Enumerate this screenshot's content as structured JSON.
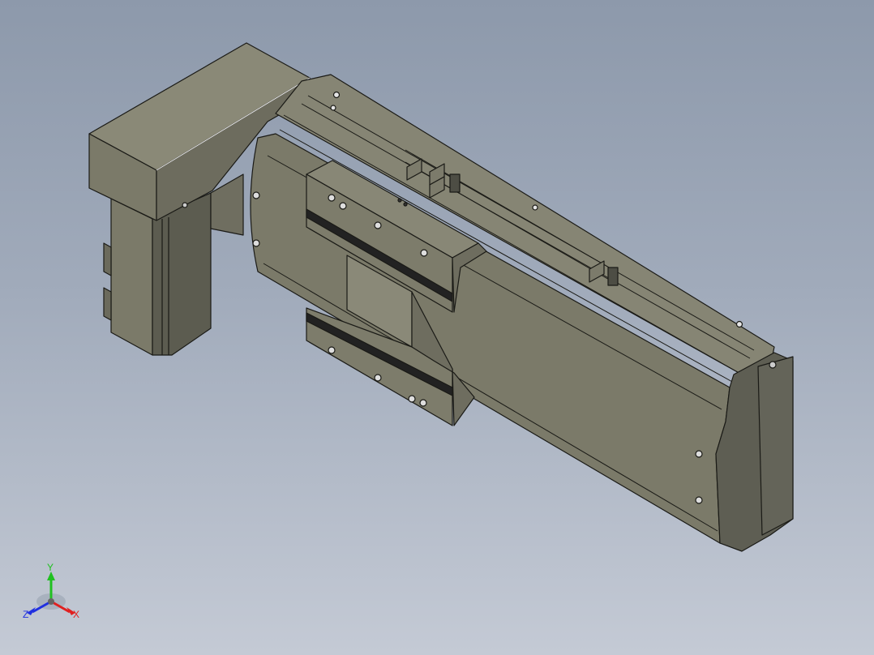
{
  "viewport": {
    "background_top": "#8d99ab",
    "background_bottom": "#c4cad5"
  },
  "model": {
    "body_color": "#7b7a69",
    "body_light": "#8f8e7c",
    "body_dark": "#55554a",
    "edge_color": "#1a1a16"
  },
  "triad": {
    "x_label": "X",
    "y_label": "Y",
    "z_label": "Z",
    "x_color": "#e02020",
    "y_color": "#20c020",
    "z_color": "#2030e0"
  }
}
